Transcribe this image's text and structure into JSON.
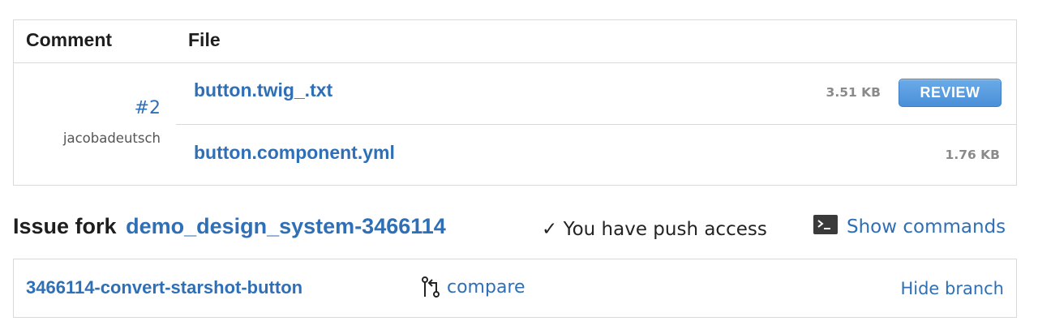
{
  "files_table": {
    "headers": {
      "comment": "Comment",
      "file": "File"
    },
    "comment": {
      "number": "#2",
      "author": "jacobadeutsch"
    },
    "files": [
      {
        "name": "button.twig_.txt",
        "size": "3.51 KB",
        "action": "REVIEW"
      },
      {
        "name": "button.component.yml",
        "size": "1.76 KB"
      }
    ]
  },
  "issue_fork": {
    "label": "Issue fork",
    "name": "demo_design_system-3466114",
    "push_access": "✓ You have push access",
    "terminal_icon": "terminal-icon",
    "show_commands": "Show commands"
  },
  "branch": {
    "name": "3466114-convert-starshot-button",
    "compare_icon": "compare-icon",
    "compare_label": "compare",
    "hide_label": "Hide branch"
  },
  "colors": {
    "link": "#2f6fb6",
    "border": "#d9d9d9",
    "button": "#4a8fd8",
    "muted": "#8a8a8a"
  }
}
